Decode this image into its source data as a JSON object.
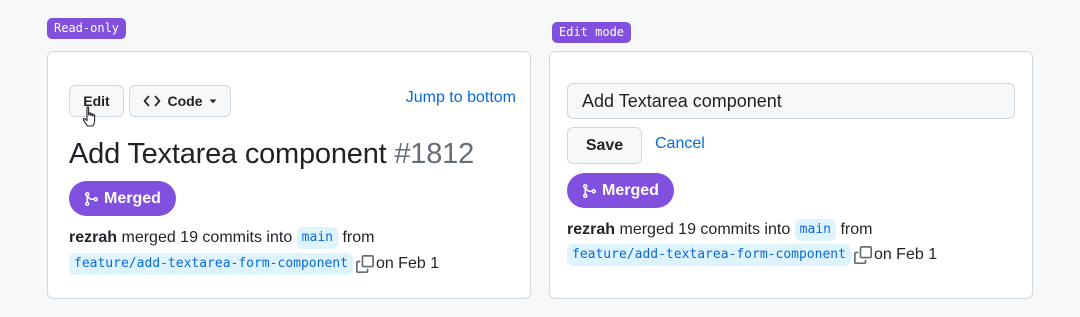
{
  "readonly": {
    "tag": "Read-only",
    "edit_label": "Edit",
    "code_label": "Code",
    "jump_label": "Jump to bottom",
    "title": "Add Textarea component",
    "number": "#1812",
    "badge_label": "Merged",
    "author": "rezrah",
    "merged_text": "merged 19 commits into",
    "base_branch": "main",
    "from_text": "from",
    "head_branch": "feature/add-textarea-form-component",
    "date_text": "on Feb 1"
  },
  "editmode": {
    "tag": "Edit mode",
    "input_value": "Add Textarea component",
    "save_label": "Save",
    "cancel_label": "Cancel",
    "badge_label": "Merged",
    "author": "rezrah",
    "merged_text": "merged 19 commits into",
    "base_branch": "main",
    "from_text": "from",
    "head_branch": "feature/add-textarea-form-component",
    "date_text": "on Feb 1"
  },
  "icons": {
    "code": "code-icon",
    "caret": "triangle-down-icon",
    "merge": "git-merge-icon",
    "copy": "copy-icon",
    "cursor": "hand-pointer-cursor"
  },
  "colors": {
    "accent": "#8250df",
    "link": "#0969da",
    "branch_bg": "#ddf4ff",
    "border": "#d0d7de",
    "background": "#f6f8fa"
  }
}
